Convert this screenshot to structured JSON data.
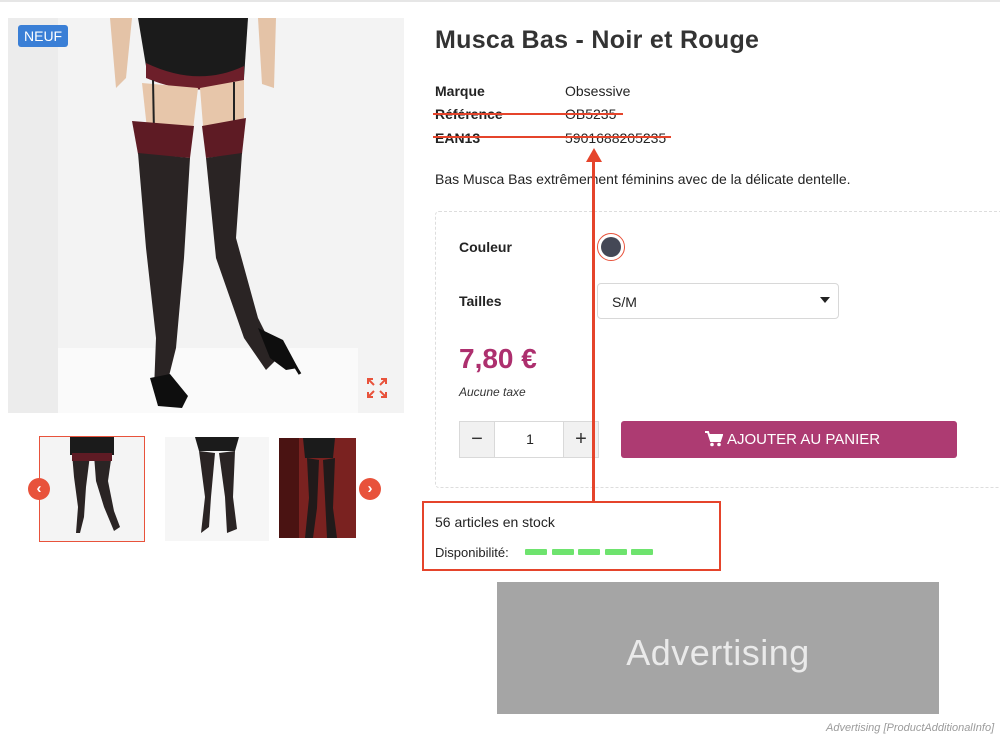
{
  "product": {
    "badge": "NEUF",
    "title": "Musca Bas - Noir et Rouge",
    "specs": {
      "brand_label": "Marque",
      "brand_value": "Obsessive",
      "reference_label": "Référence",
      "reference_value": "OB5235",
      "ean_label": "EAN13",
      "ean_value": "5901688205235"
    },
    "description": "Bas Musca Bas extrêmement féminins avec de la délicate dentelle.",
    "variants": {
      "color_label": "Couleur",
      "color_value": "#444856",
      "size_label": "Tailles",
      "size_selected": "S/M"
    },
    "price": "7,80 €",
    "tax_note": "Aucune taxe",
    "quantity": "1",
    "add_to_cart_label": "AJOUTER AU PANIER",
    "stock": {
      "count_text": "56 articles en stock",
      "availability_label": "Disponibilité:",
      "availability_level": 5,
      "availability_max": 5,
      "bar_color": "#6ee36e"
    }
  },
  "advertising": {
    "banner_text": "Advertising",
    "caption": "Advertising [ProductAdditionalInfo]"
  },
  "colors": {
    "accent": "#e8523b",
    "price": "#ad2f6e",
    "button": "#ad3b72",
    "badge": "#3a7fd6",
    "annotation": "#e5442b"
  },
  "icons": [
    "expand-icon",
    "chevron-left-icon",
    "chevron-right-icon",
    "minus-icon",
    "plus-icon",
    "cart-icon",
    "caret-down-icon"
  ]
}
